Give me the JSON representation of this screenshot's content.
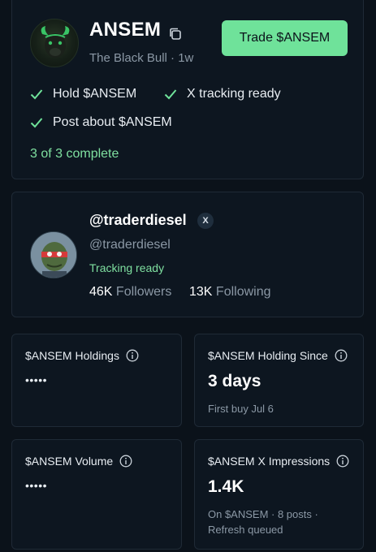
{
  "token": {
    "name": "ANSEM",
    "subtitle": "The Black Bull · 1w",
    "trade_button": "Trade $ANSEM"
  },
  "tasks": [
    {
      "label": "Hold $ANSEM",
      "done": true
    },
    {
      "label": "X tracking ready",
      "done": true
    },
    {
      "label": "Post about $ANSEM",
      "done": true
    }
  ],
  "progress": "3 of 3 complete",
  "profile": {
    "handle": "@traderdiesel",
    "x_badge": "X",
    "username": "@traderdiesel",
    "status": "Tracking ready",
    "followers_count": "46K",
    "followers_label": "Followers",
    "following_count": "13K",
    "following_label": "Following"
  },
  "stats": {
    "holdings": {
      "label": "$ANSEM Holdings",
      "value": "•••••"
    },
    "holding_since": {
      "label": "$ANSEM Holding Since",
      "value": "3 days",
      "sub": "First buy Jul 6"
    },
    "volume": {
      "label": "$ANSEM Volume",
      "value": "•••••"
    },
    "impressions": {
      "label": "$ANSEM X Impressions",
      "value": "1.4K",
      "sub": "On $ANSEM · 8 posts · Refresh queued"
    }
  },
  "colors": {
    "accent": "#6fe29a",
    "success_text": "#7fe0a0",
    "background": "#0b121a",
    "card": "#0d1620",
    "muted": "#8b98a5"
  },
  "icons": [
    "bull-avatar",
    "copy-icon",
    "check-icon",
    "x-logo-icon",
    "info-icon"
  ]
}
